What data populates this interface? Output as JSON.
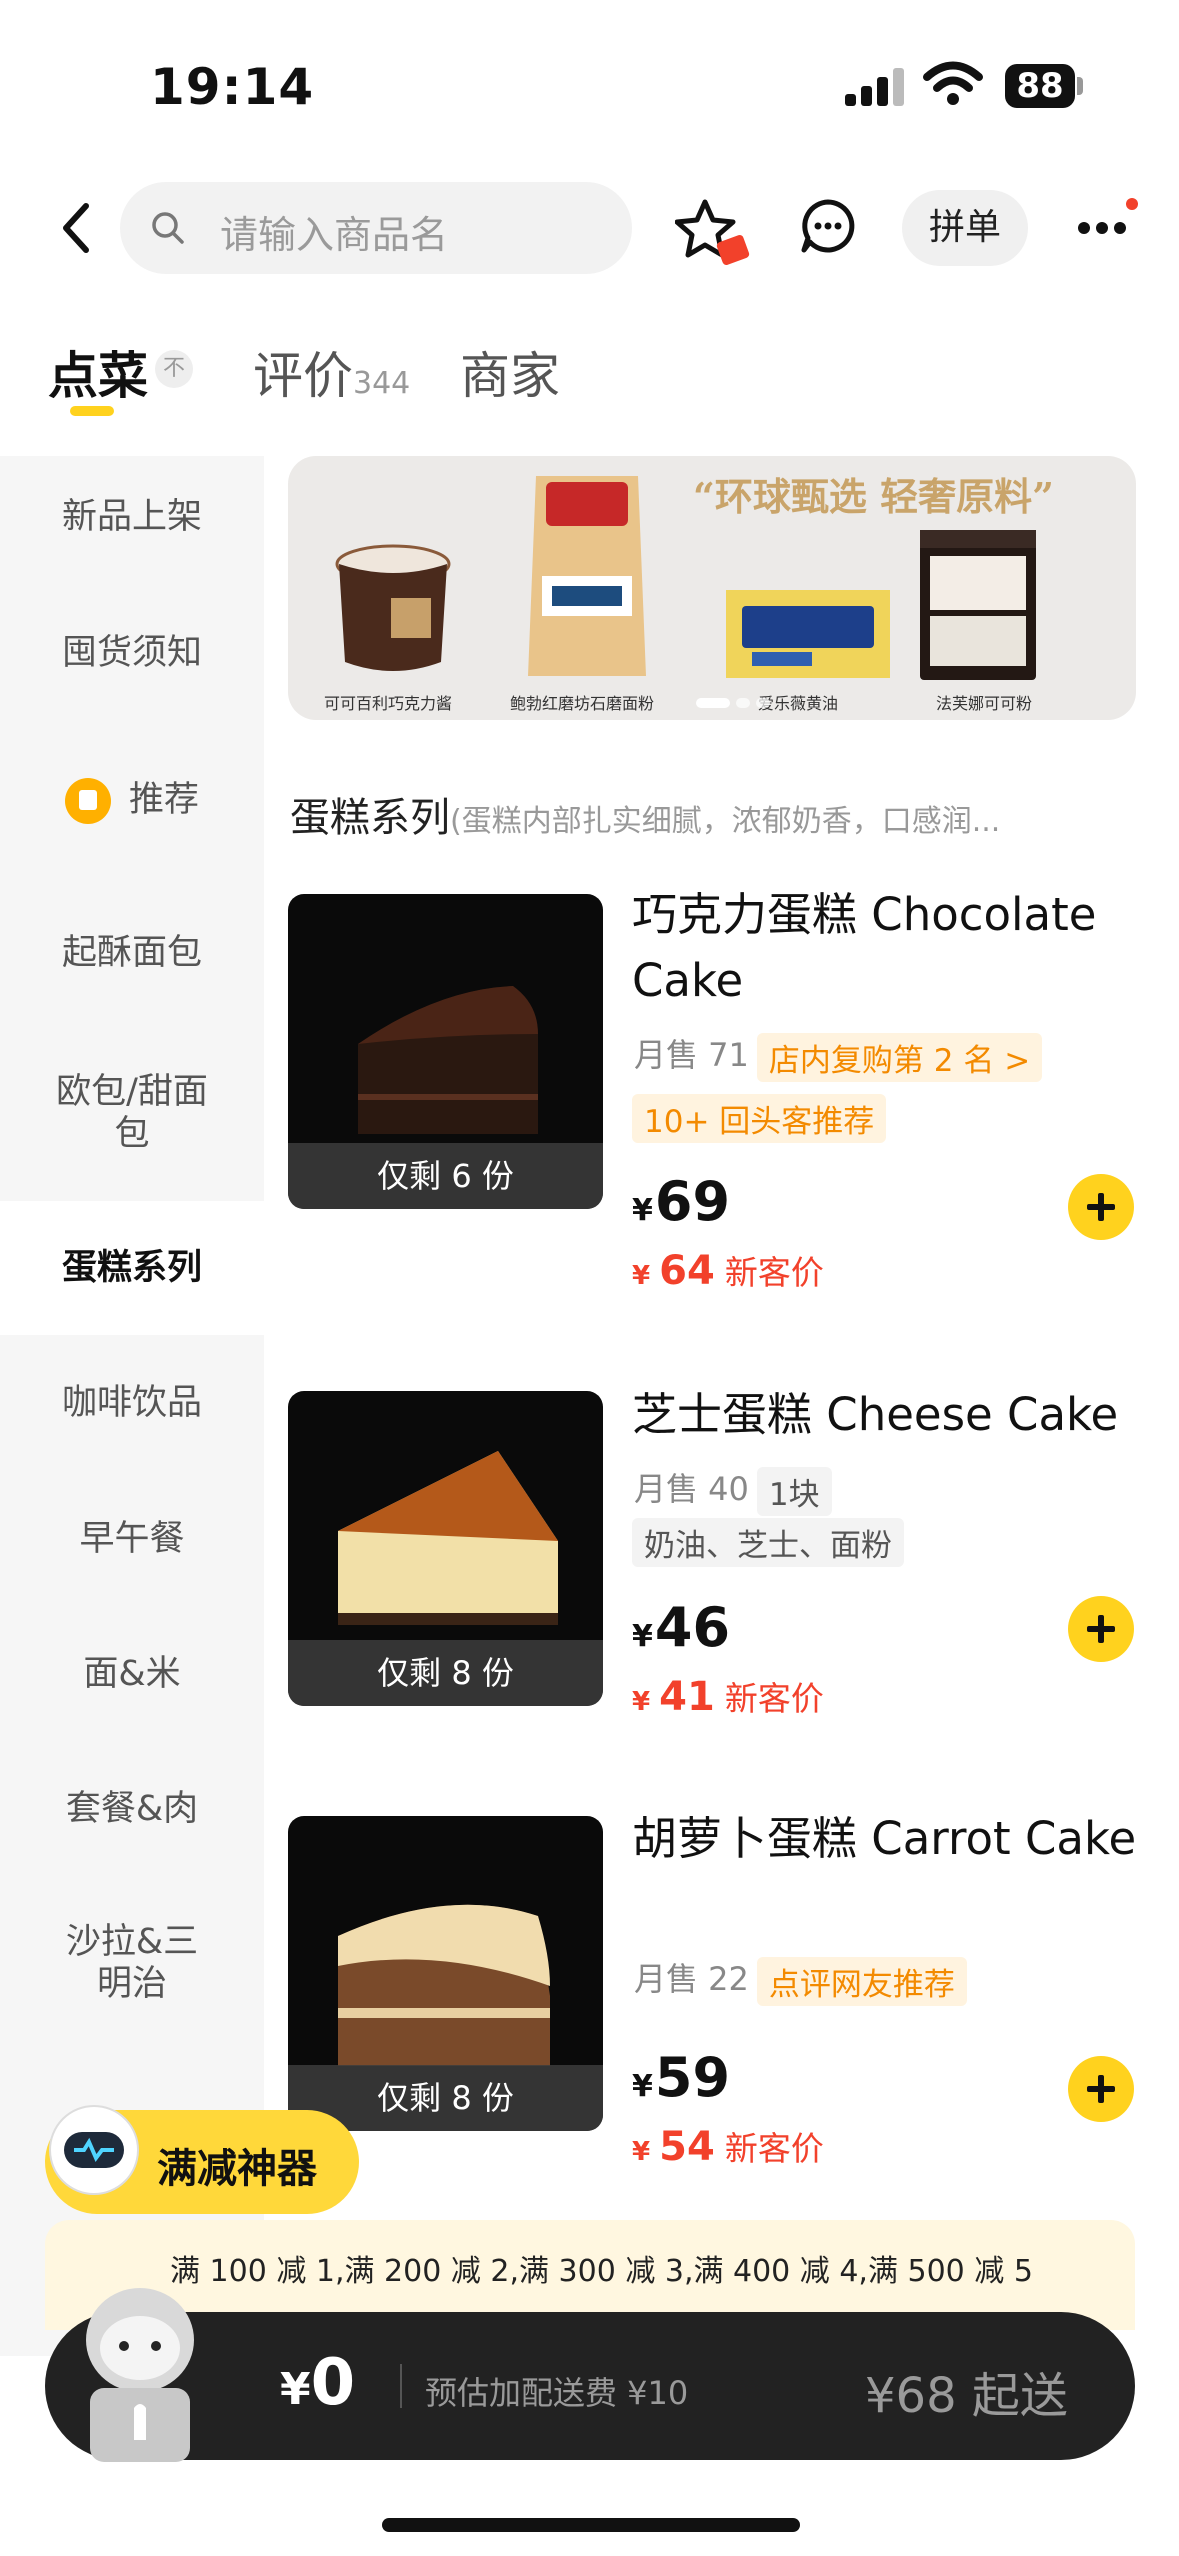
{
  "status_bar": {
    "time": "19:14",
    "battery": "88"
  },
  "nav": {
    "search_placeholder": "请输入商品名",
    "group_order_label": "拼单"
  },
  "tabs": [
    {
      "label": "点菜",
      "collapse_icon": "不"
    },
    {
      "label": "评价",
      "count": "344"
    },
    {
      "label": "商家"
    }
  ],
  "sidebar": {
    "items": [
      {
        "label": "新品上架"
      },
      {
        "label": "囤货须知"
      },
      {
        "label": "推荐"
      },
      {
        "label": "起酥面包"
      },
      {
        "label": "欧包/甜面包"
      },
      {
        "label": "蛋糕系列"
      },
      {
        "label": "咖啡饮品"
      },
      {
        "label": "早午餐"
      },
      {
        "label": "面&米"
      },
      {
        "label": "套餐&肉"
      },
      {
        "label": "沙拉&三明治"
      }
    ]
  },
  "banner": {
    "title": "“环球甄选 轻奢原料”",
    "products": [
      {
        "label": "可可百利巧克力酱"
      },
      {
        "label": "鲍勃红磨坊石磨面粉"
      },
      {
        "label": "爱乐薇黄油"
      },
      {
        "label": "法芙娜可可粉"
      }
    ]
  },
  "section": {
    "title": "蛋糕系列",
    "desc": "(蛋糕内部扎实细腻，浓郁奶香，口感润..."
  },
  "products": [
    {
      "name": "巧克力蛋糕 Chocolate Cake",
      "sales": "月售 71",
      "rank_badge": "店内复购第 2 名 >",
      "tag": "10+ 回头客推荐",
      "price": "69",
      "new_price": "64",
      "new_label": "新客价",
      "stock": "仅剩 6 份",
      "image_colors": {
        "top": "#3a1f14",
        "body": "#2a1810"
      }
    },
    {
      "name": "芝士蛋糕 Cheese Cake",
      "sales": "月售 40",
      "spec": "1块",
      "tag": "奶油、芝士、面粉",
      "price": "46",
      "new_price": "41",
      "new_label": "新客价",
      "stock": "仅剩 8 份",
      "image_colors": {
        "top": "#b4591a",
        "body": "#f2e0a8"
      }
    },
    {
      "name": "胡萝卜蛋糕 Carrot Cake",
      "sales": "月售 22",
      "rank_badge": "点评网友推荐",
      "price": "59",
      "new_price": "54",
      "new_label": "新客价",
      "stock": "仅剩 8 份",
      "image_colors": {
        "top": "#f1dcae",
        "body": "#7a4a2a"
      }
    }
  ],
  "promo": {
    "label": "满减神器"
  },
  "discount_text": "满 100 减 1,满 200 减 2,满 300 减 3,满 400 减 4,满 500 减 5",
  "cart": {
    "total": "0",
    "delivery_fee": "预估加配送费 ¥10",
    "min_order": "¥68 起送"
  },
  "colors": {
    "accent": "#ffd21e",
    "price_red": "#f2412b",
    "badge_orange": "#f38a00"
  }
}
